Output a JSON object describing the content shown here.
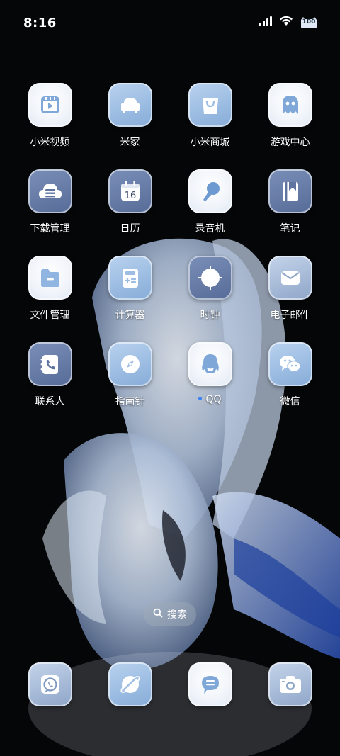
{
  "status_bar": {
    "time": "8:16",
    "battery_level": "100",
    "icons": [
      "signal-icon",
      "wifi-icon",
      "battery-icon"
    ]
  },
  "apps": [
    {
      "label": "小米视频",
      "icon": "video-icon"
    },
    {
      "label": "米家",
      "icon": "sofa-icon"
    },
    {
      "label": "小米商城",
      "icon": "shopping-bag-icon"
    },
    {
      "label": "游戏中心",
      "icon": "ghost-icon"
    },
    {
      "label": "下载管理",
      "icon": "cloud-download-icon"
    },
    {
      "label": "日历",
      "icon": "calendar-icon",
      "day": "16"
    },
    {
      "label": "录音机",
      "icon": "microphone-icon"
    },
    {
      "label": "笔记",
      "icon": "notebook-icon"
    },
    {
      "label": "文件管理",
      "icon": "folder-icon"
    },
    {
      "label": "计算器",
      "icon": "calculator-icon"
    },
    {
      "label": "时钟",
      "icon": "clock-icon"
    },
    {
      "label": "电子邮件",
      "icon": "envelope-icon"
    },
    {
      "label": "联系人",
      "icon": "phone-book-icon"
    },
    {
      "label": "指南针",
      "icon": "compass-icon"
    },
    {
      "label": "QQ",
      "icon": "qq-penguin-icon",
      "new_indicator": true
    },
    {
      "label": "微信",
      "icon": "wechat-icon"
    }
  ],
  "search": {
    "label": "搜索"
  },
  "dock": [
    {
      "icon": "phone-icon"
    },
    {
      "icon": "browser-icon"
    },
    {
      "icon": "messages-icon"
    },
    {
      "icon": "camera-icon"
    }
  ],
  "colors": {
    "tile_white": "#f0f4fa",
    "tile_light": "#9dbde3",
    "tile_slate": "#5f74a0",
    "glyph_blue": "#6d9bd1",
    "new_dot": "#3b82f6"
  }
}
